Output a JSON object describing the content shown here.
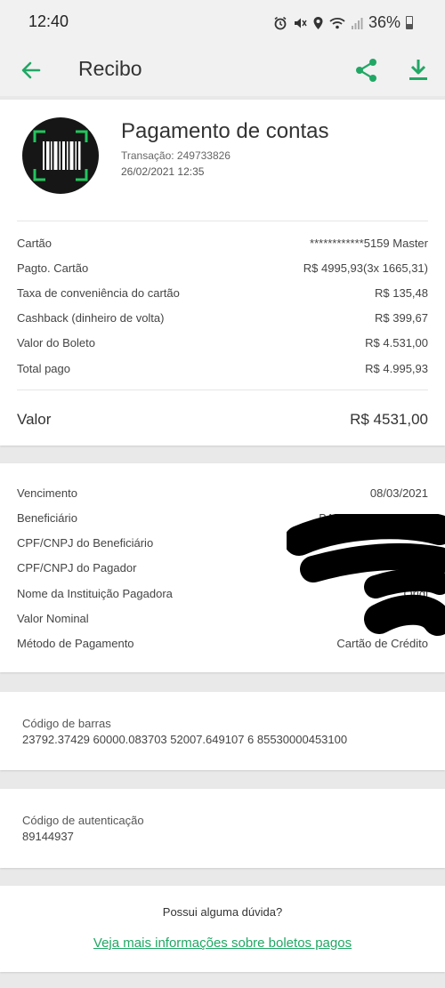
{
  "status_bar": {
    "time": "12:40",
    "battery": "36%",
    "icons": [
      "alarm-icon",
      "mute-icon",
      "location-icon",
      "wifi-icon",
      "signal-icon",
      "battery-icon"
    ]
  },
  "app_bar": {
    "title": "Recibo",
    "back_icon": "arrow-left-icon",
    "share_icon": "share-icon",
    "download_icon": "download-icon",
    "accent_color": "#22a765"
  },
  "summary": {
    "icon": "barcode-scan-icon",
    "title": "Pagamento de contas",
    "transaction": "Transação: 249733826",
    "datetime": "26/02/2021 12:35",
    "rows": [
      {
        "label": "Cartão",
        "value": "************5159 Master"
      },
      {
        "label": "Pagto. Cartão",
        "value": "R$ 4995,93(3x 1665,31)"
      },
      {
        "label": "Taxa de conveniência do cartão",
        "value": "R$ 135,48"
      },
      {
        "label": "Cashback (dinheiro de volta)",
        "value": "R$ 399,67"
      },
      {
        "label": "Valor do Boleto",
        "value": "R$ 4.531,00"
      },
      {
        "label": "Total pago",
        "value": "R$ 4.995,93"
      }
    ],
    "total_label": "Valor",
    "total_value": "R$ 4531,00"
  },
  "details": {
    "rows": [
      {
        "label": "Vencimento",
        "value": "08/03/2021"
      },
      {
        "label": "Beneficiário",
        "value": "BANCO BRADESCO"
      },
      {
        "label": "CPF/CNPJ do Beneficiário",
        "value": ""
      },
      {
        "label": "CPF/CNPJ do Pagador",
        "value": ""
      },
      {
        "label": "Nome da Instituição Pagadora",
        "value": "Origi"
      },
      {
        "label": "Valor Nominal",
        "value": ""
      },
      {
        "label": "Método de Pagamento",
        "value": "Cartão de Crédito"
      }
    ]
  },
  "barcode": {
    "label": "Código de barras",
    "value": "23792.37429 60000.083703 52007.649107 6 85530000453100"
  },
  "auth": {
    "label": "Código de autenticação",
    "value": "89144937"
  },
  "help": {
    "question": "Possui alguma dúvida?",
    "link": "Veja mais informações sobre boletos pagos"
  }
}
